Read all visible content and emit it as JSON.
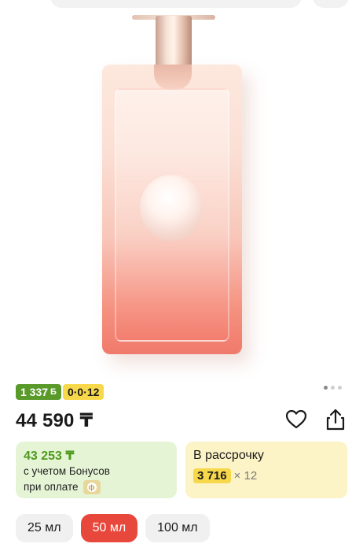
{
  "product": {
    "image_name": "perfume-bottle",
    "carousel": {
      "total": 3,
      "active": 1
    }
  },
  "badges": {
    "bonus": "1 337",
    "bonus_currency": "Б",
    "installment": "0·0·12"
  },
  "price": {
    "current": "44 590 ₸"
  },
  "bonus_card": {
    "price": "43 253 ₸",
    "line1": "с учетом Бонусов",
    "line2": "при оплате",
    "badge_icon": "kaspi-icon"
  },
  "installment_card": {
    "title": "В рассрочку",
    "amount": "3 716",
    "multiplier": "× 12"
  },
  "volumes": {
    "options": [
      "25 мл",
      "50 мл",
      "100 мл"
    ],
    "selected": "50 мл"
  },
  "colors": {
    "accent": "#e8473b",
    "bonus_green": "#5a9a2b",
    "installment_yellow": "#f7d84a"
  }
}
